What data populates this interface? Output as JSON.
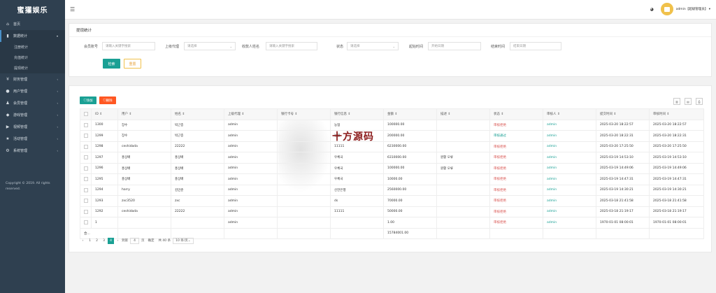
{
  "app": {
    "title": "蜜獾娱乐"
  },
  "sidebar": {
    "items": [
      {
        "label": "首页",
        "icon": "home-icon"
      },
      {
        "label": "数据统计",
        "icon": "chart-icon",
        "open": true
      },
      {
        "label": "财务管理",
        "icon": "finance-icon"
      },
      {
        "label": "用户管理",
        "icon": "user-icon"
      },
      {
        "label": "会员管理",
        "icon": "member-icon"
      },
      {
        "label": "游戏管理",
        "icon": "game-icon"
      },
      {
        "label": "视频管理",
        "icon": "video-icon"
      },
      {
        "label": "活动管理",
        "icon": "event-icon"
      },
      {
        "label": "系统管理",
        "icon": "settings-icon"
      }
    ],
    "subitems": [
      "注册统计",
      "充值统计",
      "提现统计"
    ],
    "copyright": "Copyright © 2019. All rights reserved."
  },
  "topbar": {
    "user": "admin【超级管理员】"
  },
  "filter": {
    "title": "提现统计",
    "member_label": "会员账号",
    "member_placeholder": "请输入关键字搜索",
    "agent_label": "上级代理",
    "agent_placeholder": "请选择",
    "payee_label": "收款人姓名",
    "payee_placeholder": "请输入关键字搜索",
    "status_label": "状态",
    "status_placeholder": "请选择",
    "start_label": "起始时间",
    "start_placeholder": "开始日期",
    "end_label": "结束时间",
    "end_placeholder": "结束日期",
    "search_label": "检索",
    "reset_label": "重置"
  },
  "toolbar": {
    "add_label": "添加",
    "delete_label": "删除"
  },
  "table": {
    "headers": [
      "ID",
      "用户",
      "姓名",
      "上级代理",
      "银行卡号",
      "银行信息",
      "金额",
      "描述",
      "状态",
      "审核人",
      "提交时间",
      "审核时间"
    ],
    "rows": [
      [
        "1300",
        "장수",
        "박근종",
        "admin",
        "",
        "농협",
        "100000.00",
        "",
        "审核拒绝",
        "admin",
        "2025-03-20 18:22:57",
        "2025-03-20 18:22:57"
      ],
      [
        "1299",
        "장수",
        "박근종",
        "admin",
        "",
        "농협",
        "200000.00",
        "",
        "审核通过",
        "admin",
        "2025-03-20 18:22:31",
        "2025-03-20 18:22:31"
      ],
      [
        "1298",
        "ceshidada",
        "22222",
        "admin",
        "",
        "11111",
        "6230000.00",
        "",
        "审核拒绝",
        "admin",
        "2025-03-20 17:25:50",
        "2025-03-20 17:25:50"
      ],
      [
        "1297",
        "홍상배",
        "홍상배",
        "admin",
        "",
        "우체국",
        "6310000.00",
        "원활 오류",
        "审核拒绝",
        "admin",
        "2025-03-19 14:53:10",
        "2025-03-19 14:53:10"
      ],
      [
        "1296",
        "홍상배",
        "홍상배",
        "admin",
        "",
        "우체국",
        "100000.00",
        "원활 오류",
        "审核拒绝",
        "admin",
        "2025-03-19 14:49:06",
        "2025-03-19 14:49:06"
      ],
      [
        "1295",
        "홍상배",
        "홍상배",
        "admin",
        "",
        "우체국",
        "10000.00",
        "",
        "审核拒绝",
        "admin",
        "2025-03-19 14:47:31",
        "2025-03-19 14:47:31"
      ],
      [
        "1294",
        "harry",
        "김민준",
        "admin",
        "",
        "신한은행",
        "2560000.00",
        "",
        "审核拒绝",
        "admin",
        "2025-03-19 14:30:21",
        "2025-03-19 14:30:21"
      ],
      [
        "1293",
        "zxc3520",
        "zxc",
        "admin",
        "",
        "ds",
        "70000.00",
        "",
        "审核拒绝",
        "admin",
        "2025-03-18 21:41:58",
        "2025-03-18 21:41:58"
      ],
      [
        "1292",
        "ceshidada",
        "22222",
        "admin",
        "",
        "11111",
        "50000.00",
        "",
        "审核拒绝",
        "admin",
        "2025-03-18 21:19:17",
        "2025-03-18 21:19:17"
      ],
      [
        "1",
        "",
        "",
        "admin",
        "",
        "",
        "1.00",
        "",
        "审核拒绝",
        "admin",
        "1970-01-01 08:00:01",
        "1970-01-01 08:00:01"
      ]
    ],
    "total_label": "合...",
    "total_amount": "15784001.00"
  },
  "pagination": {
    "pages": [
      "1",
      "2",
      "3",
      "4"
    ],
    "current": "4",
    "goto_label": "到第",
    "goto_value": "4",
    "page_unit": "页",
    "confirm_label": "确定",
    "total": "共 40 条",
    "page_size": "10 条/页"
  },
  "watermark": "十方源码",
  "colors": {
    "sidebar": "#2f4050",
    "accent": "#1aa094",
    "danger": "#ff5722",
    "fail_text": "#d9534f"
  }
}
